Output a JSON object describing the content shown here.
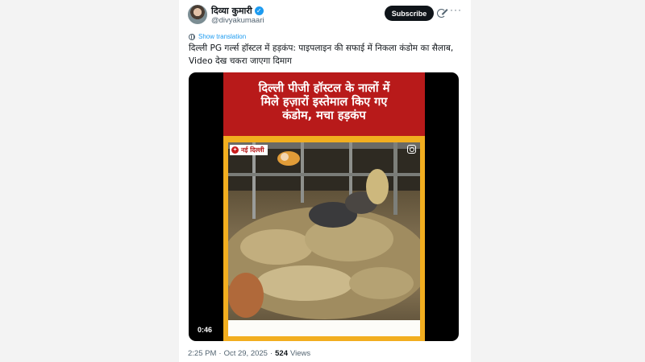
{
  "author": {
    "display_name": "दिव्या कुमारी",
    "handle": "@divyakumaari",
    "verified": true,
    "avatar_icon": "profile-photo"
  },
  "actions": {
    "subscribe_label": "Subscribe",
    "grok_icon": "grok-icon",
    "more_icon": "more-icon",
    "more_glyph": "···"
  },
  "translation": {
    "label": "Show translation",
    "icon": "globe-icon"
  },
  "tweet": {
    "text_line1": "दिल्ली PG गर्ल्स हॉस्टल में हड़कंप: पाइपलाइन की सफाई में निकला कंडोम का सैलाब,",
    "text_line2": "Video देख चकरा जाएगा दिमाग"
  },
  "media": {
    "type": "video",
    "headline_line1": "दिल्ली पीजी हॉस्टल के नालों में",
    "headline_line2": "मिले हज़ारों इस्तेमाल किए गए",
    "headline_line3": "कंडोम, मचा हड़कंप",
    "place_label": "नई दिल्ली",
    "duration": "0:46",
    "colors": {
      "frame": "#f2ae1f",
      "headline_bg": "#b81a1a",
      "headline_text": "#ffffff"
    }
  },
  "meta": {
    "time": "2:25 PM",
    "separator": "·",
    "date": "Oct 29, 2025",
    "views_count": "524",
    "views_label": "Views"
  },
  "colors": {
    "accent": "#1d9bf0",
    "text": "#0f1419",
    "muted": "#536471"
  }
}
